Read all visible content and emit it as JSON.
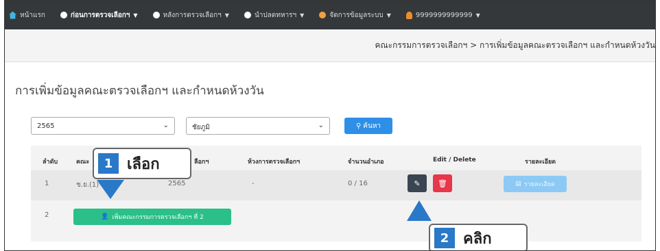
{
  "navbar": {
    "items": [
      {
        "label": "หน้าแรก",
        "icon": "home-icon"
      },
      {
        "label": "ก่อนการตรวจเลือกฯ",
        "icon": "circle-icon",
        "active": true
      },
      {
        "label": "หลังการตรวจเลือกฯ",
        "icon": "circle-icon"
      },
      {
        "label": "นำปลดทหารฯ",
        "icon": "circle-icon"
      },
      {
        "label": "จัดการข้อมูลระบบ",
        "icon": "gear-icon"
      },
      {
        "label": "9999999999999",
        "icon": "user-icon"
      }
    ]
  },
  "breadcrumb": "คณะกรรมการตรวจเลือกฯ > การเพิ่มข้อมูลคณะตรวจเลือกฯ และกำหนดห้วงวัน",
  "page_title": "การเพิ่มข้อมูลคณะตรวจเลือกฯ และกำหนดห้วงวัน",
  "filters": {
    "year_value": "2565",
    "province_value": "ชัยภูมิ",
    "search_label": "ค้นหา"
  },
  "table": {
    "headers": [
      "ลำดับ",
      "คณะ",
      "ลือกฯ",
      "ห้วงการตรวจเลือกฯ",
      "จำนวนอำเภอ",
      "Edit / Delete",
      "รายละเอียด"
    ],
    "rows": [
      {
        "no": "1",
        "committee": "ช.ย.(1)",
        "year": "2565",
        "period": "-",
        "count": "0 / 16"
      },
      {
        "no": "2"
      }
    ],
    "detail_label": "รายละเอียด",
    "add_label": "เพิ่มคณะกรรมการตรวจเลือกฯ ที่ 2"
  },
  "callouts": {
    "one": {
      "num": "1",
      "text": "เลือก"
    },
    "two": {
      "num": "2",
      "text": "คลิก"
    }
  },
  "colors": {
    "navbar": "#35383b",
    "primary": "#2e8fe8",
    "danger": "#e8364a",
    "success": "#2bbf8a",
    "badge": "#2a78c8"
  }
}
